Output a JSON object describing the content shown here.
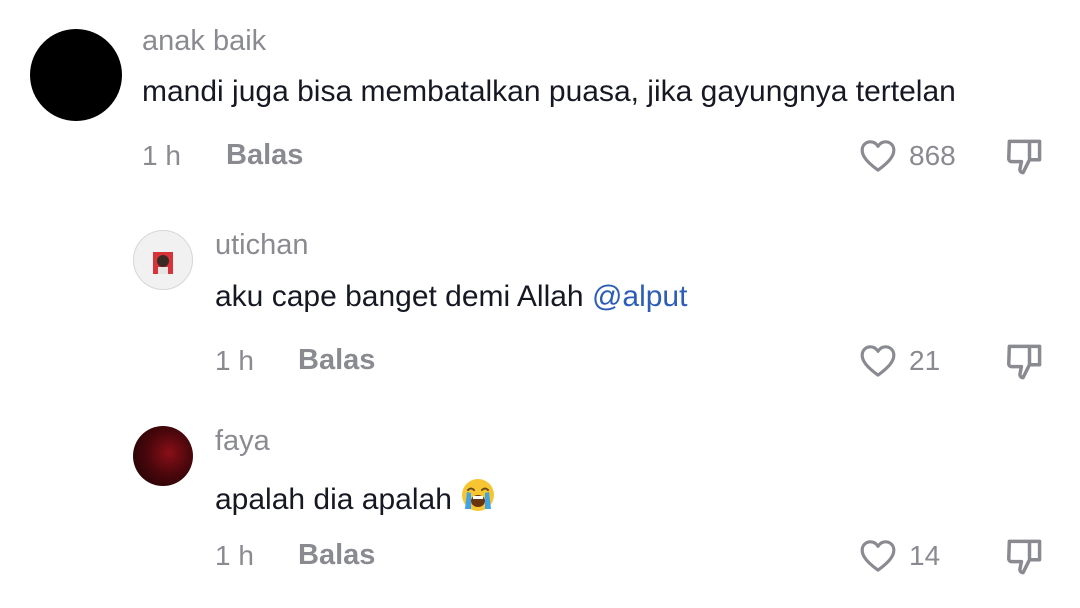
{
  "comments": [
    {
      "username": "anak baik",
      "text": "mandi juga bisa membatalkan puasa, jika gayungnya tertelan",
      "time": "1 h",
      "reply_label": "Balas",
      "likes": "868"
    },
    {
      "username": "utichan",
      "text": "aku cape banget demi Allah ",
      "mention": "@alput",
      "time": "1 h",
      "reply_label": "Balas",
      "likes": "21"
    },
    {
      "username": "faya",
      "text": "apalah dia apalah",
      "emoji": "loudly-crying-face-emoji",
      "time": "1 h",
      "reply_label": "Balas",
      "likes": "14"
    }
  ],
  "colors": {
    "username": "#8a8b91",
    "text": "#161823",
    "mention": "#2b5db9",
    "meta": "#8a8b91",
    "icon_stroke": "#8a8b91"
  },
  "icons": {
    "like": "heart-icon",
    "dislike": "thumbs-down-icon"
  }
}
